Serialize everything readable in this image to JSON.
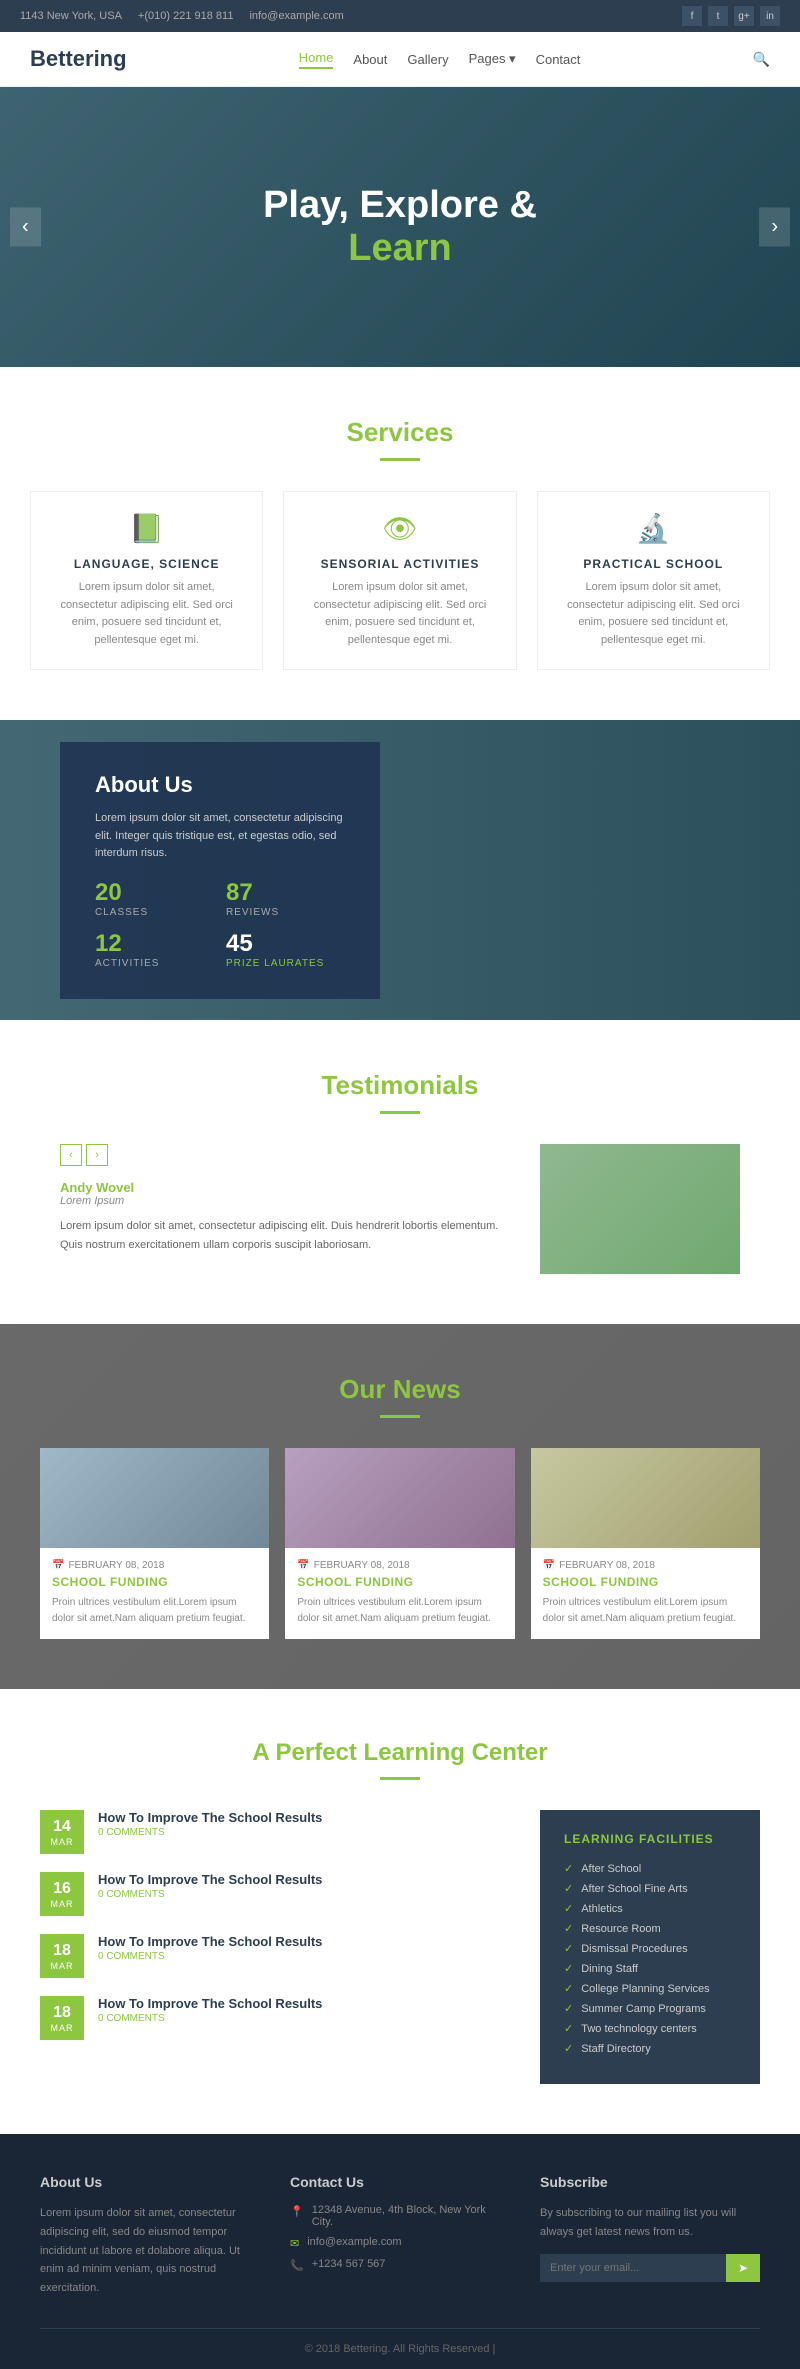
{
  "topbar": {
    "address": "1143 New York, USA",
    "phone": "+(010) 221 918 811",
    "email": "info@example.com",
    "social": [
      "f",
      "t",
      "g+",
      "in"
    ]
  },
  "navbar": {
    "logo": "Bettering",
    "links": [
      "Home",
      "About",
      "Gallery",
      "Pages",
      "Contact"
    ],
    "active": "Home"
  },
  "hero": {
    "line1": "Play, Explore &",
    "line2": "Learn"
  },
  "services": {
    "heading_s": "S",
    "heading_rest": "ervices",
    "items": [
      {
        "icon": "📗",
        "title": "LANGUAGE, SCIENCE",
        "text": "Lorem ipsum dolor sit amet, consectetur adipiscing elit. Sed orci enim, posuere sed tincidunt et, pellentesque eget mi."
      },
      {
        "icon": "👁",
        "title": "SENSORIAL ACTIVITIES",
        "text": "Lorem ipsum dolor sit amet, consectetur adipiscing elit. Sed orci enim, posuere sed tincidunt et, pellentesque eget mi."
      },
      {
        "icon": "🔬",
        "title": "PRACTICAL SCHOOL",
        "text": "Lorem ipsum dolor sit amet, consectetur adipiscing elit. Sed orci enim, posuere sed tincidunt et, pellentesque eget mi."
      }
    ]
  },
  "about": {
    "title": "About Us",
    "text": "Lorem ipsum dolor sit amet, consectetur adipiscing elit. Integer quis tristique est, et egestas odio, sed interdum risus.",
    "stats": [
      {
        "num": "20",
        "label": "CLASSES"
      },
      {
        "num": "87",
        "label": "REVIEWS"
      },
      {
        "num": "12",
        "label": "ACTIVITIES"
      },
      {
        "num": "45",
        "label": "PRIZE LAURATES"
      }
    ]
  },
  "testimonials": {
    "heading_T": "T",
    "heading_rest": "estimonials",
    "author": "Andy Wovel",
    "role": "Lorem Ipsum",
    "body": "Lorem ipsum dolor sit amet, consectetur adipiscing elit. Duis hendrerit lobortis elementum. Quis nostrum exercitationem ullam corporis suscipit laboriosam."
  },
  "news": {
    "heading_Our": "Our Ne",
    "heading_w": "w",
    "heading_rest": "s",
    "items": [
      {
        "date": "FEBRUARY 08, 2018",
        "title": "SCHOOL FUNDING",
        "text": "Proin ultrices vestibulum elit.Lorem ipsum dolor sit amet.Nam aliquam pretium feugiat."
      },
      {
        "date": "FEBRUARY 08, 2018",
        "title": "SCHOOL FUNDING",
        "text": "Proin ultrices vestibulum elit.Lorem ipsum dolor sit amet.Nam aliquam pretium feugiat."
      },
      {
        "date": "FEBRUARY 08, 2018",
        "title": "SCHOOL FUNDING",
        "text": "Proin ultrices vestibulum elit.Lorem ipsum dolor sit amet.Nam aliquam pretium feugiat."
      }
    ]
  },
  "learning": {
    "heading_A": "A",
    "heading_rest": " Perfect Learning Center",
    "events": [
      {
        "day": "14",
        "month": "MAR",
        "title": "How To Improve The School Results",
        "comments": "0 COMMENTS"
      },
      {
        "day": "16",
        "month": "MAR",
        "title": "How To Improve The School Results",
        "comments": "0 COMMENTS"
      },
      {
        "day": "18",
        "month": "MAR",
        "title": "How To Improve The School Results",
        "comments": "0 COMMENTS"
      },
      {
        "day": "18",
        "month": "MAR",
        "title": "How To Improve The School Results",
        "comments": "0 COMMENTS"
      }
    ],
    "facilities_title": "LEARNING FACILITIES",
    "facilities": [
      "After School",
      "After School Fine Arts",
      "Athletics",
      "Resource Room",
      "Dismissal Procedures",
      "Dining Staff",
      "College Planning Services",
      "Summer Camp Programs",
      "Two technology centers",
      "Staff Directory"
    ]
  },
  "footer": {
    "about_title": "About Us",
    "about_text": "Lorem ipsum dolor sit amet, consectetur adipiscing elit, sed do eiusmod tempor incididunt ut labore et dolabore aliqua. Ut enim ad minim veniam, quis nostrud exercitation.",
    "contact_title": "Contact Us",
    "contact_address": "12348 Avenue, 4th Block, New York City.",
    "contact_email": "info@example.com",
    "contact_phone": "+1234 567 567",
    "subscribe_title": "Subscribe",
    "subscribe_text": "By subscribing to our mailing list you will always get latest news from us.",
    "subscribe_placeholder": "Enter your email...",
    "copyright": "© 2018 Bettering. All Rights Reserved |"
  }
}
